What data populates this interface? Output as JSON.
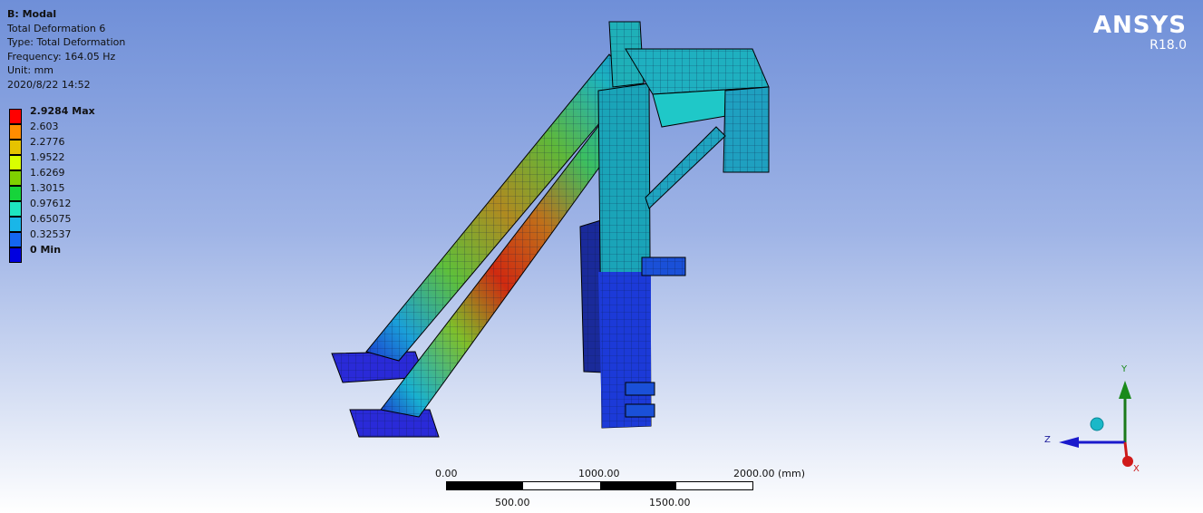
{
  "info": {
    "title": "B: Modal",
    "lines": [
      "Total Deformation 6",
      "Type: Total Deformation",
      "Frequency: 164.05 Hz",
      "Unit: mm",
      "2020/8/22 14:52"
    ]
  },
  "legend": [
    {
      "label": "2.9284 Max",
      "color": "#ff0000",
      "bold": true
    },
    {
      "label": "2.603",
      "color": "#ff8c00"
    },
    {
      "label": "2.2776",
      "color": "#e6c300"
    },
    {
      "label": "1.9522",
      "color": "#d9ff00"
    },
    {
      "label": "1.6269",
      "color": "#7fd100"
    },
    {
      "label": "1.3015",
      "color": "#16d43a"
    },
    {
      "label": "0.97612",
      "color": "#1ee6c0"
    },
    {
      "label": "0.65075",
      "color": "#19b6e8"
    },
    {
      "label": "0.32537",
      "color": "#1466f0"
    },
    {
      "label": "0 Min",
      "color": "#0000e0",
      "bold": true
    }
  ],
  "logo": {
    "brand": "ANSYS",
    "version": "R18.0"
  },
  "scale": {
    "top_labels": [
      "0.00",
      "1000.00",
      "2000.00 (mm)"
    ],
    "bottom_labels": [
      "500.00",
      "1500.00"
    ]
  },
  "triad": {
    "y": "Y",
    "z": "Z",
    "x": "X"
  }
}
